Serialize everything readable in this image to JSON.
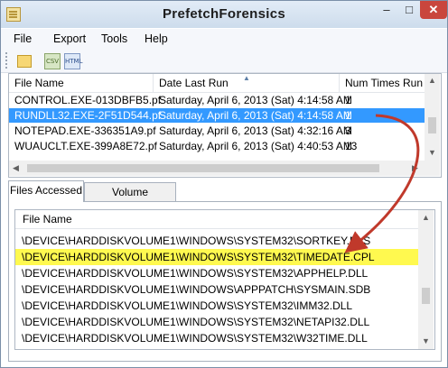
{
  "window": {
    "title": "PrefetchForensics",
    "minimize": "–",
    "maximize": "□",
    "close": "✕"
  },
  "menu": [
    "File",
    "Export",
    "Tools",
    "Help"
  ],
  "toolbar": {
    "csv_label": "CSV",
    "html_label": "HTML"
  },
  "prefetch_list": {
    "columns": [
      "File Name",
      "Date Last Run",
      "Num Times Run"
    ],
    "rows": [
      {
        "name": "CONTROL.EXE-013DBFB5.pf",
        "date": "Saturday, April 6, 2013 (Sat) 4:14:58 AM",
        "count": "1"
      },
      {
        "name": "RUNDLL32.EXE-2F51D544.pf",
        "date": "Saturday, April 6, 2013 (Sat) 4:14:58 AM",
        "count": "1"
      },
      {
        "name": "NOTEPAD.EXE-336351A9.pf",
        "date": "Saturday, April 6, 2013 (Sat) 4:32:16 AM",
        "count": "3"
      },
      {
        "name": "WUAUCLT.EXE-399A8E72.pf",
        "date": "Saturday, April 6, 2013 (Sat) 4:40:53 AM",
        "count": "13"
      }
    ],
    "selected_index": 1
  },
  "tabs": [
    "Files Accessed",
    "Volume Information"
  ],
  "files_list": {
    "column": "File Name",
    "rows": [
      "\\DEVICE\\HARDDISKVOLUME1\\WINDOWS\\SYSTEM32\\SORTKEY.NLS",
      "\\DEVICE\\HARDDISKVOLUME1\\WINDOWS\\SYSTEM32\\TIMEDATE.CPL",
      "\\DEVICE\\HARDDISKVOLUME1\\WINDOWS\\SYSTEM32\\APPHELP.DLL",
      "\\DEVICE\\HARDDISKVOLUME1\\WINDOWS\\APPPATCH\\SYSMAIN.SDB",
      "\\DEVICE\\HARDDISKVOLUME1\\WINDOWS\\SYSTEM32\\IMM32.DLL",
      "\\DEVICE\\HARDDISKVOLUME1\\WINDOWS\\SYSTEM32\\NETAPI32.DLL",
      "\\DEVICE\\HARDDISKVOLUME1\\WINDOWS\\SYSTEM32\\W32TIME.DLL"
    ],
    "highlighted_index": 1
  },
  "colors": {
    "selection": "#3399ff",
    "highlight": "#fff94f",
    "annotation_arrow": "#c0392b"
  },
  "icons": {
    "app": "app-icon",
    "open": "open-folder-icon",
    "sort": "sort-ascending-icon"
  }
}
